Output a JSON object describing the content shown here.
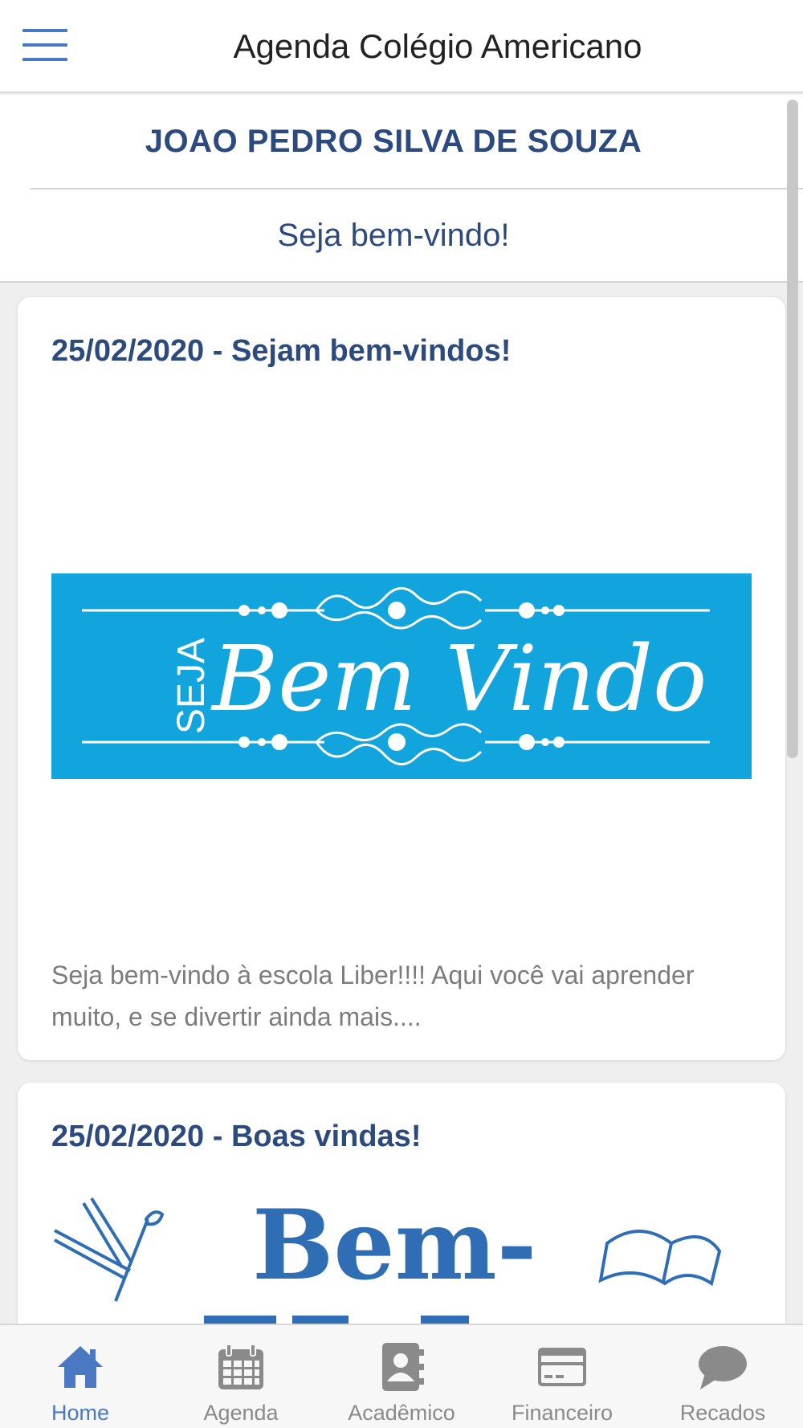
{
  "header": {
    "title": "Agenda Colégio Americano",
    "menu_icon": "hamburger-menu-icon"
  },
  "profile": {
    "student_name": "JOAO PEDRO SILVA DE SOUZA",
    "welcome": "Seja bem-vindo!"
  },
  "posts": [
    {
      "title": "25/02/2020 - Sejam bem-vindos!",
      "image_word_small": "SEJA",
      "image_words": "Bem Vindo",
      "text": "Seja bem-vindo à escola Liber!!!! Aqui você vai aprender muito, e se divertir ainda mais...."
    },
    {
      "title": "25/02/2020 - Boas vindas!",
      "image_words": "Bem-"
    }
  ],
  "nav": [
    {
      "label": "Home",
      "icon": "home-icon",
      "active": true
    },
    {
      "label": "Agenda",
      "icon": "calendar-icon",
      "active": false
    },
    {
      "label": "Acadêmico",
      "icon": "contact-book-icon",
      "active": false
    },
    {
      "label": "Financeiro",
      "icon": "credit-card-icon",
      "active": false
    },
    {
      "label": "Recados",
      "icon": "chat-bubble-icon",
      "active": false
    }
  ],
  "colors": {
    "accent": "#4a78c2",
    "heading": "#2d4a7e",
    "banner": "#12a4dd",
    "sketch_blue": "#2f6db5"
  }
}
